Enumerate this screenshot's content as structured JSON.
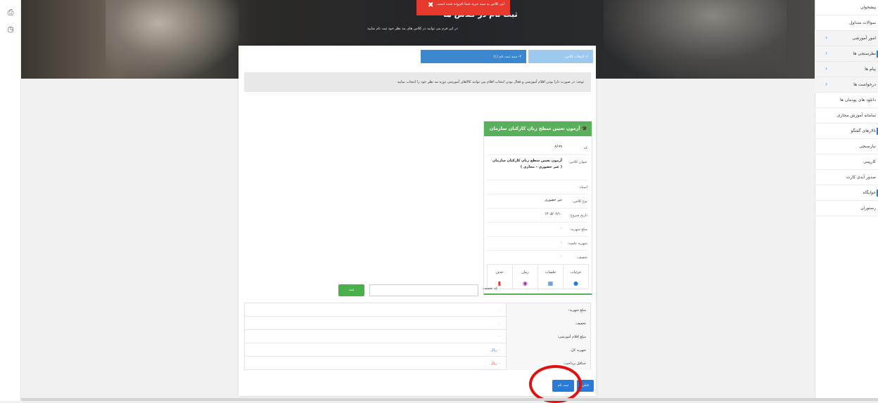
{
  "toast": {
    "message": "این کلاس به سبد خرید شما افزوده شده است.",
    "close": "✖"
  },
  "hero": {
    "title": "ثبت نام در کلاس ها",
    "subtitle": "در این فرم می توانید در کلاس های مد نظر خود ثبت نام نمایید"
  },
  "steps": [
    {
      "label": "۱- انتخاب کلاس"
    },
    {
      "label": "۲- سبد ثبت نام (۱)"
    }
  ],
  "notice": "توجه: در صورت دارا بودن اقلام آموزشی و فعال بودن انتخاب اقلام می توانید کالاهای آموزشی دوره مد نظر خود را انتخاب نمایید",
  "class_card": {
    "title": "آزمون تعیین سطح زبان کارکنان سازمان",
    "rows": [
      {
        "key": "کد:",
        "value": "۸۶۹۹"
      },
      {
        "key": "عنوان کلاس:",
        "value": "آزمون تعیین سطح زبان کارکنان سازمان ( غیر حضوری - مجازی )"
      },
      {
        "key": "استاد:",
        "value": ""
      },
      {
        "key": "نوع کلاس:",
        "value": "غیر حضوری"
      },
      {
        "key": "تاریخ شروع:",
        "value": "۱۴۰۵/۰۶/۱۰"
      },
      {
        "key": "مبلغ شهریه:",
        "value": "۰"
      },
      {
        "key": "شهریه جلسه:",
        "value": "۰"
      },
      {
        "key": "تخفیف:",
        "value": "۰"
      }
    ],
    "actions": [
      {
        "label": "جزئیات",
        "icon": "eye-icon",
        "glyph": "●",
        "color": "#2a7bd8"
      },
      {
        "label": "جلسات",
        "icon": "calendar-icon",
        "glyph": "▦",
        "color": "#2a7bd8"
      },
      {
        "label": "زمان",
        "icon": "clock-icon",
        "glyph": "◉",
        "color": "#9c27b0"
      },
      {
        "label": "حذف",
        "icon": "trash-icon",
        "glyph": "▮",
        "color": "#e53935"
      }
    ]
  },
  "coupon": {
    "label": "کد تخفیف:",
    "placeholder": "",
    "button": "ثبت"
  },
  "summary": [
    {
      "key": "مبلغ شهریه:",
      "value": "۰",
      "color": "#555555"
    },
    {
      "key": "تخفیف:",
      "value": "۰",
      "color": "#555555"
    },
    {
      "key": "مبلغ اقلام آموزشی:",
      "value": "۰",
      "color": "#555555"
    },
    {
      "key": "شهریه کل:",
      "value": "۰ ریال",
      "color": "#2a7bd8"
    },
    {
      "key": "حداقل پرداخت:",
      "value": "۰ ریال",
      "color": "#e53935"
    }
  ],
  "buttons": {
    "back": "قبلی",
    "register": "ثبت نام"
  },
  "sidebar": [
    {
      "label": "پیشخوان",
      "chevron": false
    },
    {
      "label": "سوالات متداول",
      "chevron": false
    },
    {
      "label": "امور آموزشی",
      "chevron": true
    },
    {
      "label": "نظرسنجی ها",
      "chevron": true
    },
    {
      "label": "پیام ها",
      "chevron": true
    },
    {
      "label": "درخواست ها",
      "chevron": true
    },
    {
      "label": "دانلود های پودمان ها",
      "chevron": false
    },
    {
      "label": "سامانه آموزش مجازی",
      "chevron": false
    },
    {
      "label": "تالارهای گفتگو",
      "chevron": false
    },
    {
      "label": "نیازسنجی",
      "chevron": false
    },
    {
      "label": "کارپینی",
      "chevron": false
    },
    {
      "label": "صدور آیدی کارت",
      "chevron": false
    },
    {
      "label": "خوابگاه",
      "chevron": false
    },
    {
      "label": "رستوران",
      "chevron": false
    }
  ]
}
